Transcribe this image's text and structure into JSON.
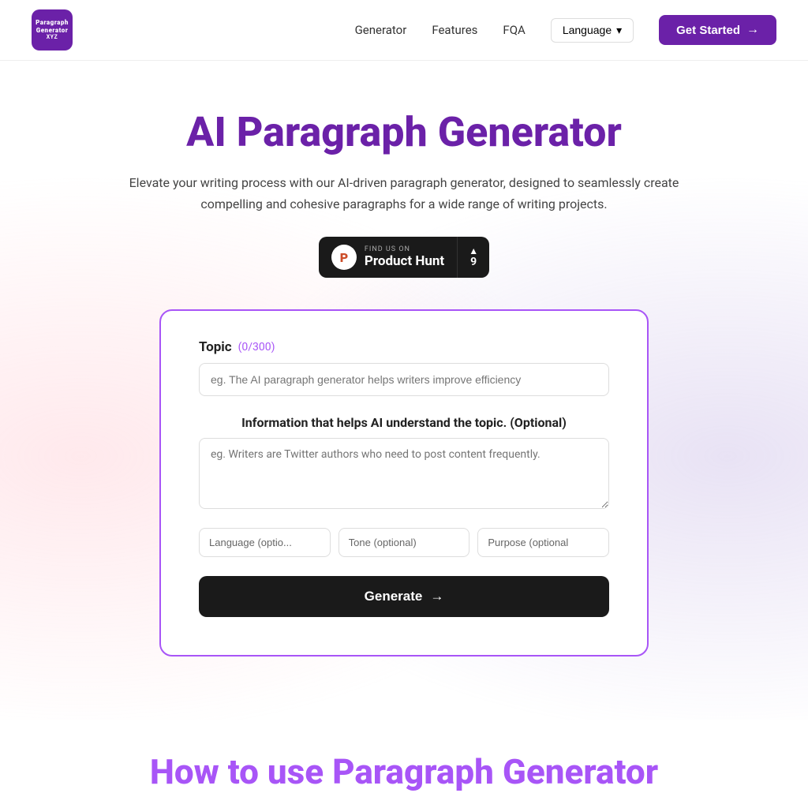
{
  "nav": {
    "logo_lines": [
      "Paragraph",
      "Generator",
      "XYZ"
    ],
    "links": [
      "Generator",
      "Features",
      "FQA"
    ],
    "language_label": "Language",
    "get_started_label": "Get Started"
  },
  "hero": {
    "title": "AI Paragraph Generator",
    "subtitle": "Elevate your writing process with our AI-driven paragraph generator, designed to seamlessly create compelling and cohesive paragraphs for a wide range of writing projects."
  },
  "product_hunt": {
    "find_us": "FIND US ON",
    "name": "Product Hunt",
    "votes": "9"
  },
  "form": {
    "topic_label": "Topic",
    "char_count": "(0/300)",
    "topic_placeholder": "eg. The AI paragraph generator helps writers improve efficiency",
    "info_label": "Information that helps AI understand the topic. (Optional)",
    "info_placeholder": "eg. Writers are Twitter authors who need to post content frequently.",
    "language_placeholder": "Language (optio...",
    "tone_placeholder": "Tone (optional)",
    "purpose_placeholder": "Purpose (optional",
    "generate_label": "Generate"
  },
  "how_section": {
    "title": "How to use Paragraph Generator"
  }
}
